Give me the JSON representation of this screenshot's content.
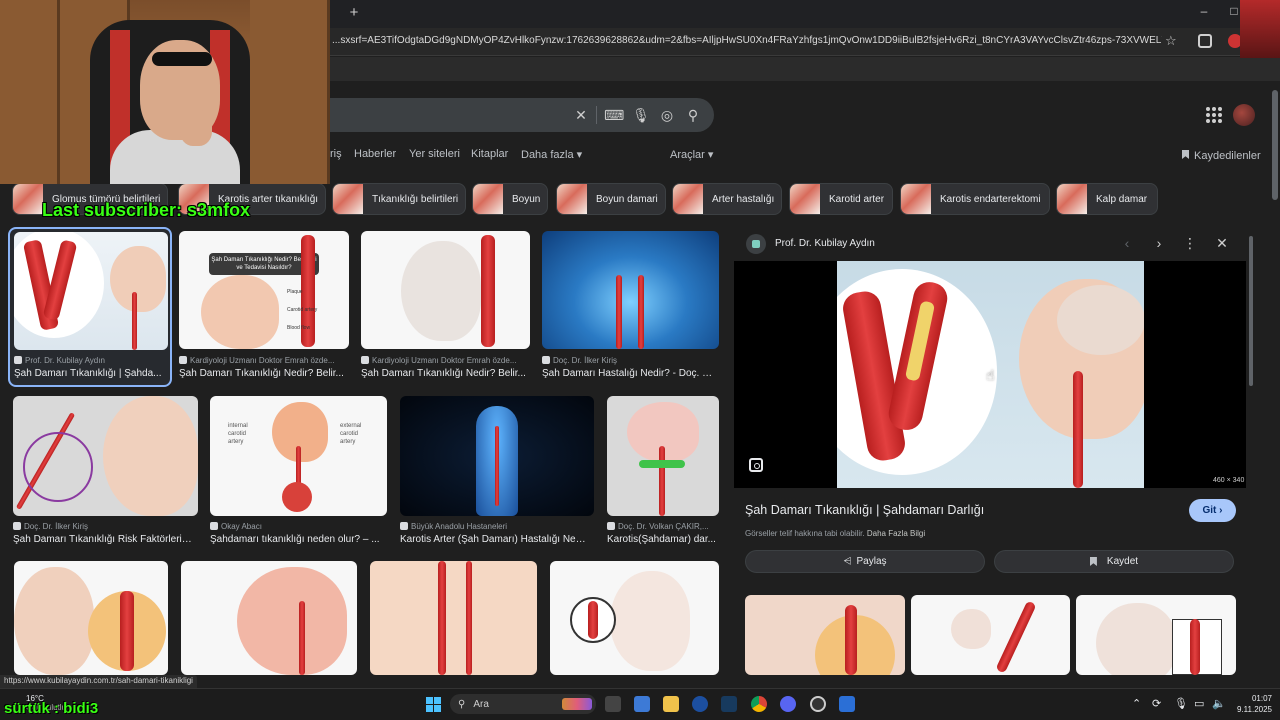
{
  "browser": {
    "new_tab": "+",
    "url": "...sxsrf=AE3TifOdgtaDGd9gNDMyOP4ZvHlkoFynzw:1762639628862&udm=2&fbs=AIljpHwSU0Xn4FRaYzhfgs1jmQvOnw1DD9iiBulB2fsjeHv6Rzi_t8nCYrA3VAYvcClsvZtr46zps-73XVWEL76eMkvfHLfzKU...",
    "status_url": "https://www.kubilayaydin.com.tr/sah-damari-tikanikligi"
  },
  "google": {
    "nav_tabs": [
      "riş",
      "Haberler",
      "Yer siteleri",
      "Kitaplar",
      "Daha fazla ▾",
      "Araçlar ▾"
    ],
    "saved": "Kaydedilenler"
  },
  "chips": [
    "Glomus tümörü belirtileri",
    "Karotis arter tıkanıklığı",
    "Tıkanıklığı belirtileri",
    "Boyun",
    "Boyun damari",
    "Arter hastalığı",
    "Karotid arter",
    "Karotis endarterektomi",
    "Kalp damar"
  ],
  "results": [
    {
      "source": "Prof. Dr. Kubilay Aydın",
      "title": "Şah Damarı Tıkanıklığı | Şahda..."
    },
    {
      "source": "Kardiyoloji Uzmanı Doktor Emrah özde...",
      "title": "Şah Damarı Tıkanıklığı Nedir? Belir...",
      "overlay": "Şah Damarı Tıkanıklığı Nedir? Belirtileri ve Tedavisi Nasıldır?"
    },
    {
      "source": "Kardiyoloji Uzmanı Doktor Emrah özde...",
      "title": "Şah Damarı Tıkanıklığı Nedir? Belir..."
    },
    {
      "source": "Doç. Dr. İlker Kiriş",
      "title": "Şah Damarı Hastalığı Nedir? - Doç. D..."
    },
    {
      "source": "Doç. Dr. İlker Kiriş",
      "title": "Şah Damarı Tıkanıklığı Risk Faktörleri -..."
    },
    {
      "source": "Okay Abacı",
      "title": "Şahdamarı tıkanıklığı neden olur? – ..."
    },
    {
      "source": "Büyük Anadolu Hastaneleri",
      "title": "Karotis Arter (Şah Damarı) Hastalığı Nedi..."
    },
    {
      "source": "Doç. Dr. Volkan ÇAKIR,...",
      "title": "Karotis(Şahdamar) dar..."
    }
  ],
  "diagram_labels": {
    "plaque": "Plaque",
    "carotid_artery": "Carotid artery",
    "blood_flow": "Blood flow",
    "internal": "internal carotid artery",
    "external": "external carotid artery"
  },
  "panel": {
    "source": "Prof. Dr. Kubilay Aydın",
    "dimensions": "460 × 340",
    "title": "Şah Damarı Tıkanıklığı | Şahdamarı Darlığı",
    "visit": "Git ›",
    "copyright": "Görseller telif hakkına tabi olabilir.",
    "more_info": "Daha Fazla Bilgi",
    "share": "Paylaş",
    "save": "Kaydet"
  },
  "overlay": {
    "last_subscriber": "Last subscriber: s3mfox",
    "bottom_text": "sürtük : bidi3"
  },
  "taskbar": {
    "temperature": "16°C",
    "weather": "Çok bulutlu",
    "search": "Ara",
    "time": "01:07",
    "date": "9.11.2025"
  },
  "colors": {
    "accent": "#8ab4f8",
    "visit_button": "#a8c7fa",
    "overlay_text": "#39ff14"
  }
}
